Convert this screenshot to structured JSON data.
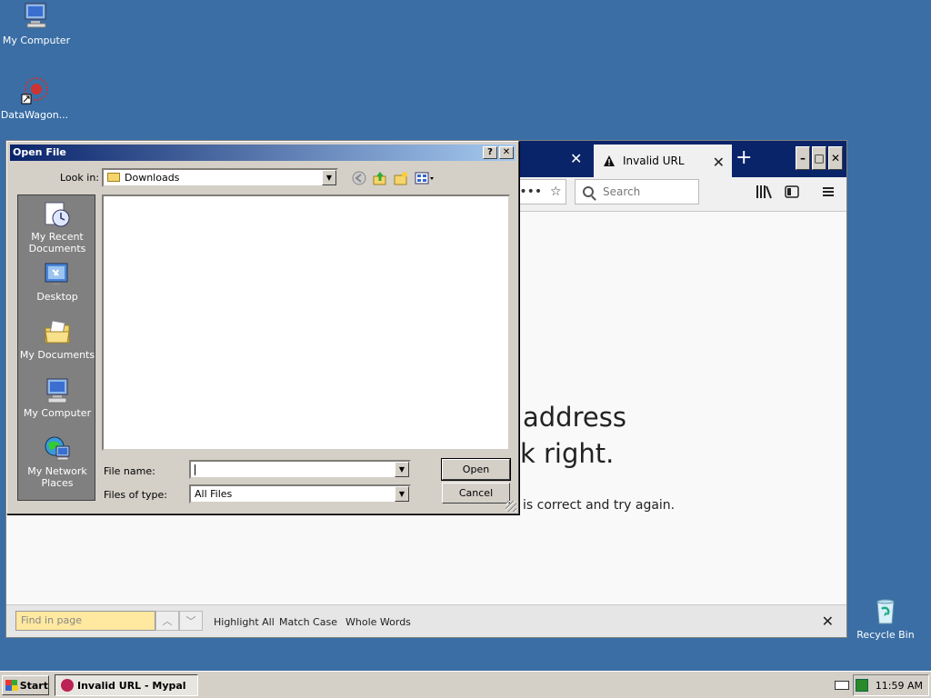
{
  "desktop": {
    "icons": [
      {
        "label": "My Computer"
      },
      {
        "label": "DataWagon..."
      },
      {
        "label": "Recycle Bin"
      }
    ]
  },
  "browser": {
    "active_tab_title": "Invalid URL",
    "search_placeholder": "Search",
    "error_heading_line1": "address",
    "error_heading_line2": "k right.",
    "error_text": "is correct and try again.",
    "findbar": {
      "placeholder": "Find in page",
      "highlight_all": "Highlight All",
      "match_case": "Match Case",
      "whole_words": "Whole Words"
    }
  },
  "dialog": {
    "title": "Open File",
    "look_in_label": "Look in:",
    "look_in_value": "Downloads",
    "places": [
      {
        "label": "My Recent Documents"
      },
      {
        "label": "Desktop"
      },
      {
        "label": "My Documents"
      },
      {
        "label": "My Computer"
      },
      {
        "label": "My Network Places"
      }
    ],
    "file_name_label": "File name:",
    "file_name_value": "",
    "files_of_type_label": "Files of type:",
    "files_of_type_value": "All Files",
    "open_label": "Open",
    "cancel_label": "Cancel"
  },
  "taskbar": {
    "start_label": "Start",
    "task_label": "Invalid URL - Mypal",
    "clock": "11:59 AM"
  },
  "colors": {
    "desktop_bg": "#3a6ea5",
    "title_gradient_start": "#0a246a",
    "title_gradient_end": "#a6caf0",
    "findbar_input": "#ffe8a0"
  }
}
